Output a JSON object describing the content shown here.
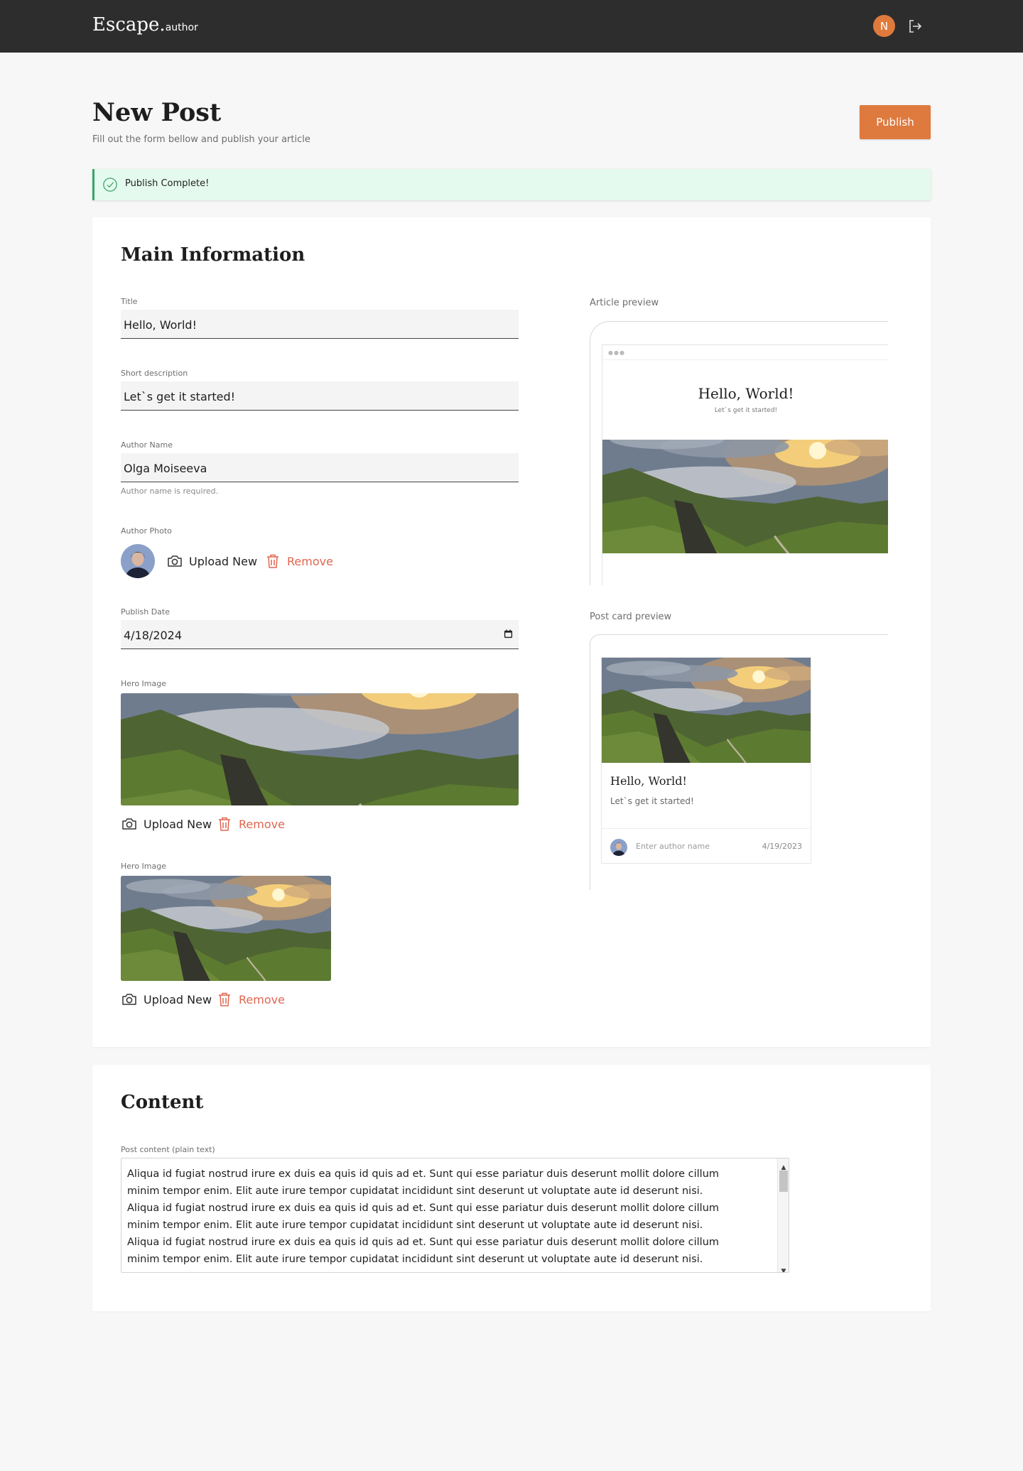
{
  "app": {
    "logo_main": "Escape.",
    "logo_sub": "author",
    "avatar_initial": "N"
  },
  "page": {
    "title": "New Post",
    "subtitle": "Fill out the form bellow and publish your article",
    "publish_label": "Publish"
  },
  "alert": {
    "message": "Publish Complete!"
  },
  "main": {
    "section_title": "Main Information",
    "title_label": "Title",
    "title_value": "Hello, World!",
    "short_desc_label": "Short description",
    "short_desc_value": "Let`s get it started!",
    "author_label": "Author Name",
    "author_value": "Olga Moiseeva",
    "author_hint": "Author name is required.",
    "photo_label": "Author Photo",
    "upload_label": "Upload New",
    "remove_label": "Remove",
    "date_label": "Publish Date",
    "date_value": "4/18/2024",
    "hero_label": "Hero Image",
    "hero_small_label": "Hero Image"
  },
  "article_preview": {
    "label": "Article preview",
    "title": "Hello, World!",
    "subtitle": "Let`s get it started!"
  },
  "card_preview": {
    "label": "Post card preview",
    "title": "Hello, World!",
    "subtitle": "Let`s get it started!",
    "author_placeholder": "Enter author name",
    "date": "4/19/2023"
  },
  "content": {
    "section_title": "Content",
    "label": "Post content (plain text)",
    "paragraphs": [
      "Aliqua id fugiat nostrud irure ex duis ea quis id quis ad et. Sunt qui esse pariatur duis deserunt mollit dolore cillum minim tempor enim. Elit aute irure tempor cupidatat incididunt sint deserunt ut voluptate aute id deserunt nisi.",
      "Aliqua id fugiat nostrud irure ex duis ea quis id quis ad et. Sunt qui esse pariatur duis deserunt mollit dolore cillum minim tempor enim. Elit aute irure tempor cupidatat incididunt sint deserunt ut voluptate aute id deserunt nisi.",
      "Aliqua id fugiat nostrud irure ex duis ea quis id quis ad et. Sunt qui esse pariatur duis deserunt mollit dolore cillum minim tempor enim. Elit aute irure tempor cupidatat incididunt sint deserunt ut voluptate aute id deserunt nisi."
    ]
  },
  "colors": {
    "accent": "#df7a3f",
    "topbar": "#2d2d2d",
    "success_bg": "#e5faee",
    "success_border": "#3aa56a",
    "danger": "#e0654f"
  },
  "icons": {
    "logout": "logout-icon",
    "success": "check-circle-icon",
    "upload": "camera-icon",
    "remove": "trash-icon",
    "calendar": "calendar-icon"
  }
}
